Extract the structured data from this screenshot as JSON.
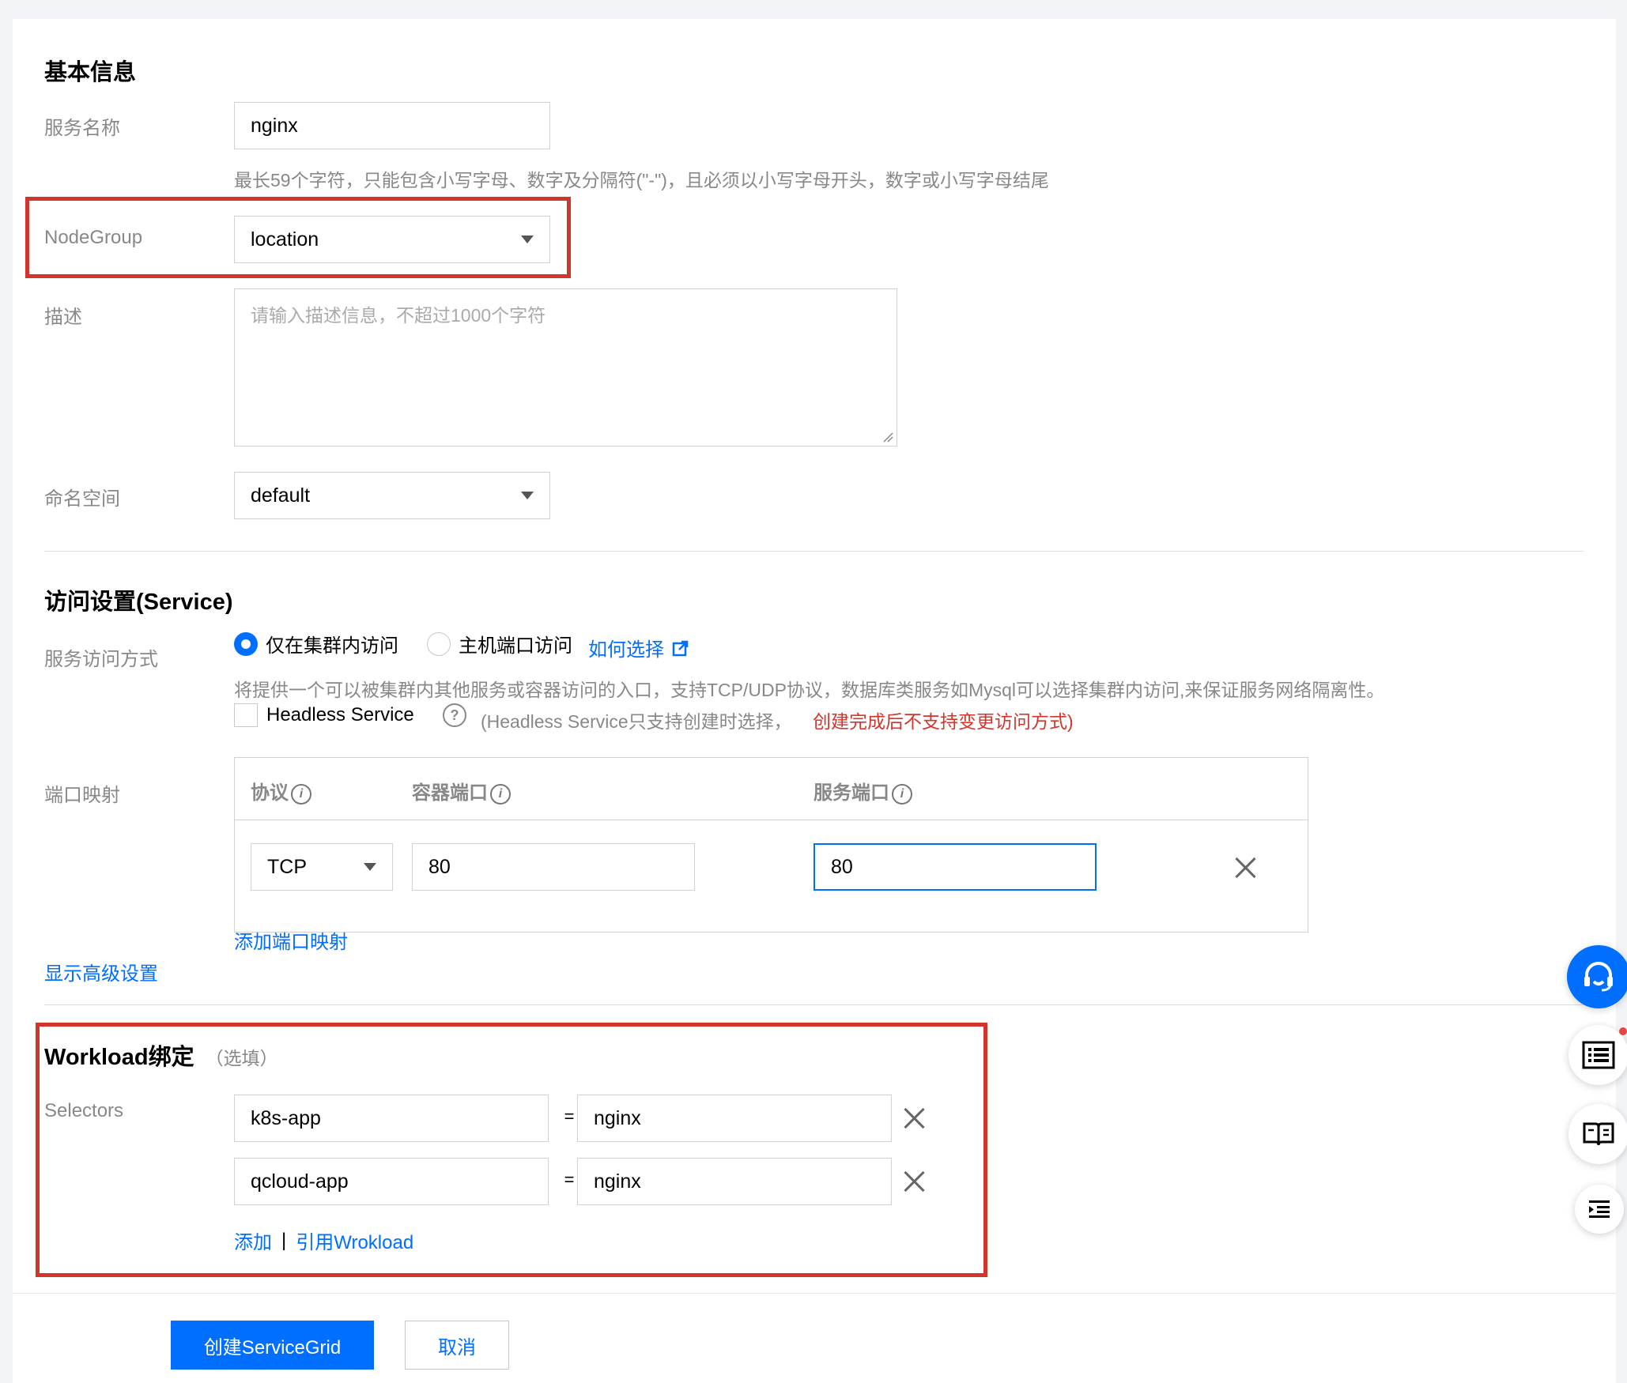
{
  "basic": {
    "title": "基本信息",
    "service_name_label": "服务名称",
    "service_name_value": "nginx",
    "service_name_hint": "最长59个字符，只能包含小写字母、数字及分隔符(\"-\")，且必须以小写字母开头，数字或小写字母结尾",
    "nodegroup_label": "NodeGroup",
    "nodegroup_value": "location",
    "desc_label": "描述",
    "desc_placeholder": "请输入描述信息，不超过1000个字符",
    "namespace_label": "命名空间",
    "namespace_value": "default"
  },
  "access": {
    "title": "访问设置(Service)",
    "mode_label": "服务访问方式",
    "option_cluster": "仅在集群内访问",
    "option_host": "主机端口访问",
    "how_choose": "如何选择",
    "mode_hint": "将提供一个可以被集群内其他服务或容器访问的入口，支持TCP/UDP协议，数据库类服务如Mysql可以选择集群内访问,来保证服务网络隔离性。",
    "headless_label": "Headless Service",
    "headless_hint": "(Headless Service只支持创建时选择，",
    "headless_warn": "创建完成后不支持变更访问方式)",
    "port_mapping_label": "端口映射",
    "col_protocol": "协议",
    "col_container_port": "容器端口",
    "col_service_port": "服务端口",
    "protocol_value": "TCP",
    "container_port_value": "80",
    "service_port_value": "80",
    "add_port_mapping": "添加端口映射",
    "show_advanced": "显示高级设置"
  },
  "workload": {
    "title": "Workload绑定",
    "optional": "（选填）",
    "selectors_label": "Selectors",
    "selectors": [
      {
        "key": "k8s-app",
        "eq": "=",
        "value": "nginx"
      },
      {
        "key": "qcloud-app",
        "eq": "=",
        "value": "nginx"
      }
    ],
    "add": "添加",
    "separator": "|",
    "ref_workload": "引用Wrokload"
  },
  "footer": {
    "create_button": "创建ServiceGrid",
    "cancel_button": "取消"
  },
  "icons": {
    "floating": [
      "headset-icon",
      "list-icon",
      "book-icon",
      "outline-icon"
    ],
    "accent": "#006eff",
    "highlight": "#d2352c"
  }
}
